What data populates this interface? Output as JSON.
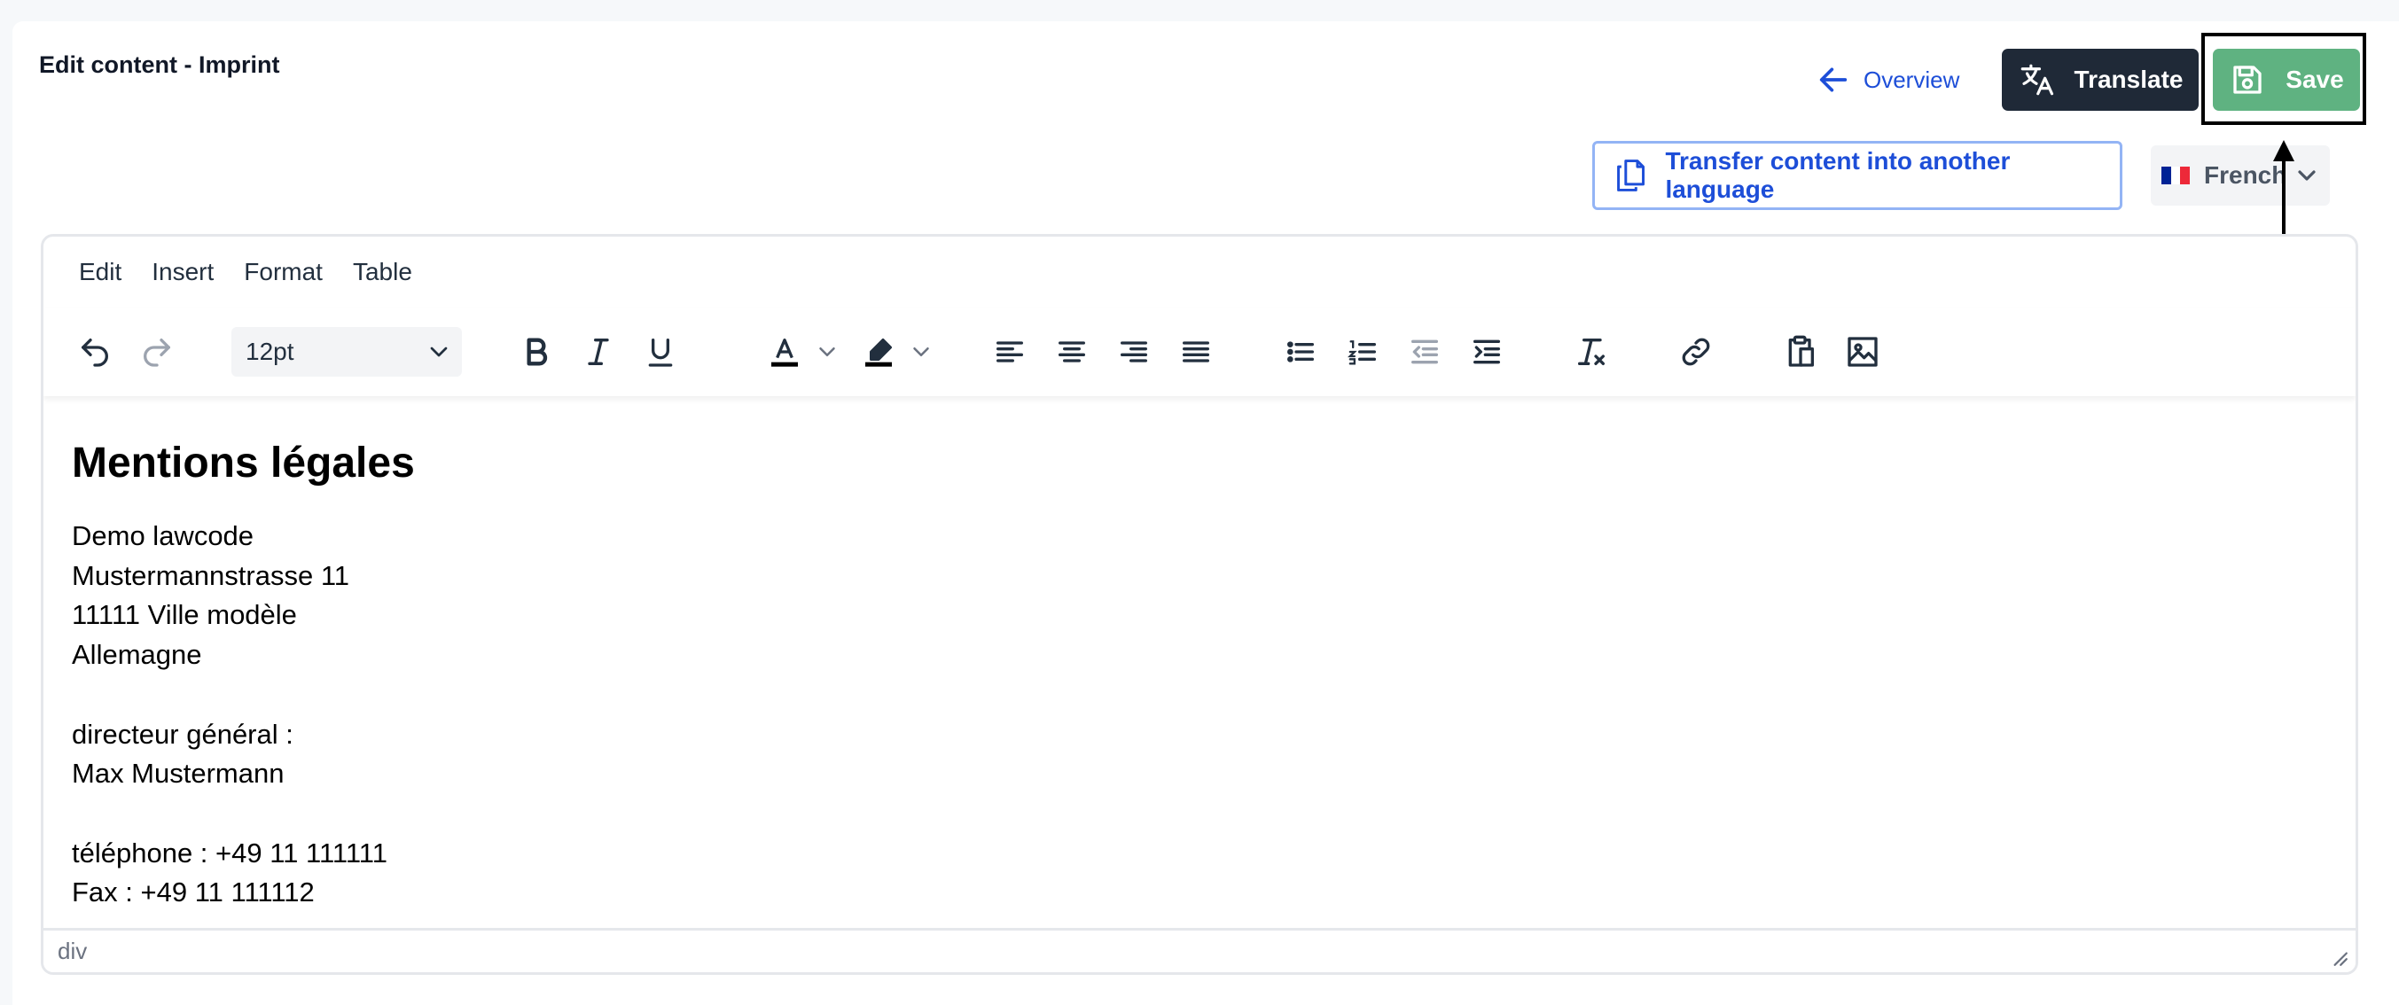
{
  "page": {
    "title": "Edit content - Imprint"
  },
  "header": {
    "overview_label": "Overview",
    "translate_label": "Translate",
    "save_label": "Save"
  },
  "actions": {
    "transfer_label": "Transfer content into another language",
    "language": {
      "selected": "French",
      "flag_colors": [
        "#002395",
        "#ffffff",
        "#ed2939"
      ]
    }
  },
  "editor": {
    "menu": [
      "Edit",
      "Insert",
      "Format",
      "Table"
    ],
    "font_size": "12pt",
    "status_path": "div",
    "content": {
      "heading": "Mentions légales",
      "lines": [
        "Demo lawcode",
        "Mustermannstrasse 11",
        "11111 Ville modèle",
        "Allemagne",
        "",
        "directeur général :",
        "Max Mustermann",
        "",
        "téléphone : +49 11 111111",
        "Fax : +49 11 111112"
      ]
    }
  },
  "colors": {
    "accent_blue": "#1d4ed8",
    "save_green": "#5fb281",
    "translate_dark": "#1f2937"
  }
}
